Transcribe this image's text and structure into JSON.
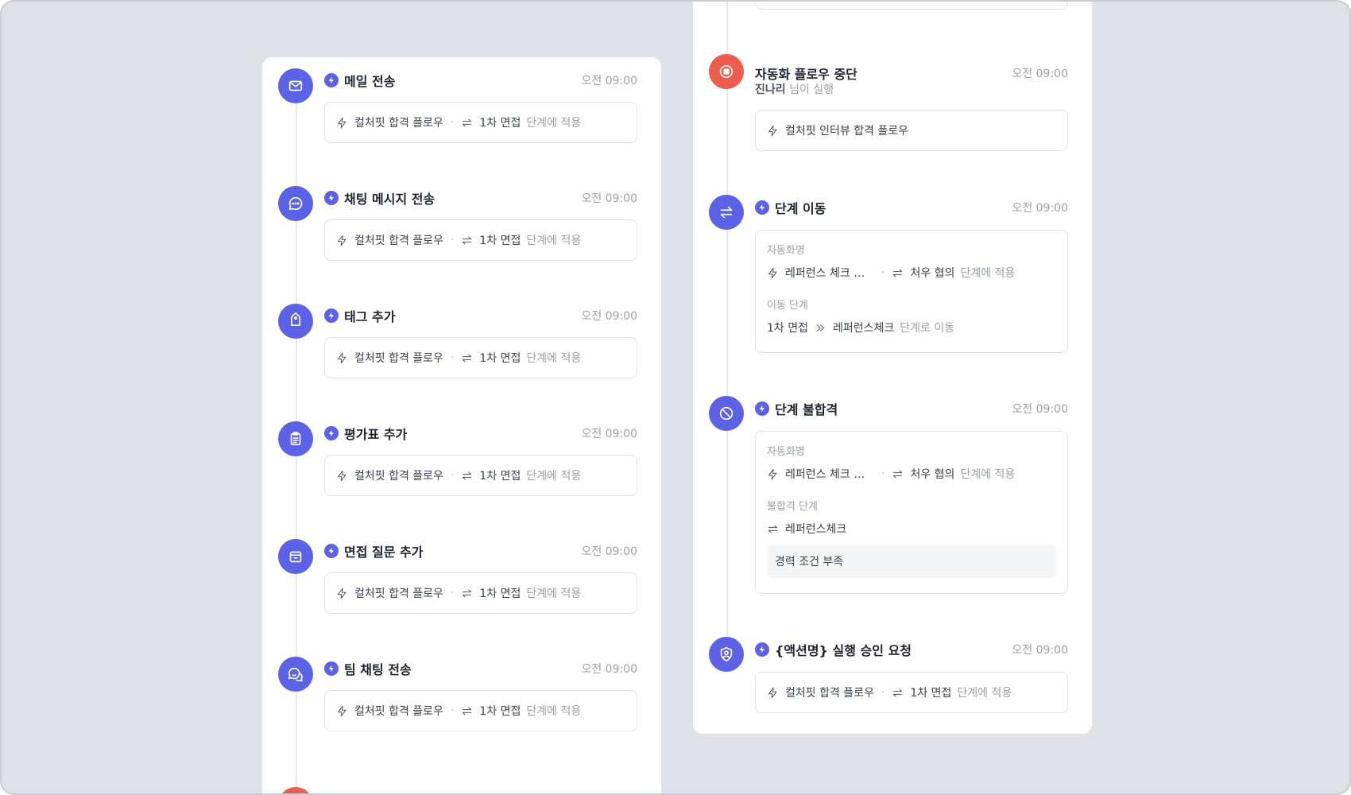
{
  "left_items": [
    {
      "title": "메일 전송",
      "time": "오전 09:00",
      "icon": "mail-icon",
      "flow": "컬처핏 합격 플로우",
      "stage": "1차 면접",
      "suffix": "단계에 적용"
    },
    {
      "title": "채팅 메시지 전송",
      "time": "오전 09:00",
      "icon": "chat-icon",
      "flow": "컬처핏 합격 플로우",
      "stage": "1차 면접",
      "suffix": "단계에 적용"
    },
    {
      "title": "태그 추가",
      "time": "오전 09:00",
      "icon": "tag-icon",
      "flow": "컬처핏 합격 플로우",
      "stage": "1차 면접",
      "suffix": "단계에 적용"
    },
    {
      "title": "평가표 추가",
      "time": "오전 09:00",
      "icon": "clipboard-icon",
      "flow": "컬처핏 합격 플로우",
      "stage": "1차 면접",
      "suffix": "단계에 적용"
    },
    {
      "title": "면접 질문 추가",
      "time": "오전 09:00",
      "icon": "archive-icon",
      "flow": "컬처핏 합격 플로우",
      "stage": "1차 면접",
      "suffix": "단계에 적용"
    },
    {
      "title": "팀 채팅 전송",
      "time": "오전 09:00",
      "icon": "team-chat-icon",
      "flow": "컬처핏 합격 플로우",
      "stage": "1차 면접",
      "suffix": "단계에 적용"
    }
  ],
  "stop": {
    "title": "자동화 플로우 중단",
    "time": "오전 09:00",
    "user": "진나리",
    "user_suffix": "님이 실행",
    "flow": "컬처핏 인터뷰 합격 플로우"
  },
  "move": {
    "title": "단계 이동",
    "time": "오전 09:00",
    "name_label": "자동화명",
    "flow": "레퍼런스 체크 단계 이동 플로우",
    "stage": "처우 협의",
    "suffix": "단계에 적용",
    "move_label": "이동 단계",
    "from": "1차 면접",
    "to": "레퍼런스체크",
    "move_suffix": "단계로 이동"
  },
  "reject": {
    "title": "단계 불합격",
    "time": "오전 09:00",
    "name_label": "자동화명",
    "flow": "레퍼런스 체크 단계 불합격 플로우",
    "stage": "처우 협의",
    "suffix": "단계에 적용",
    "reject_label": "불합격 단계",
    "reject_stage": "레퍼런스체크",
    "reason": "경력 조건 부족"
  },
  "approval": {
    "title": "{액션명} 실행 승인 요청",
    "time": "오전 09:00",
    "flow": "컬처핏 합격 플로우",
    "stage": "1차 면접",
    "suffix": "단계에 적용"
  },
  "colors": {
    "primary": "#5b62e6",
    "danger": "#ee5c50",
    "background": "#dee1e6"
  }
}
